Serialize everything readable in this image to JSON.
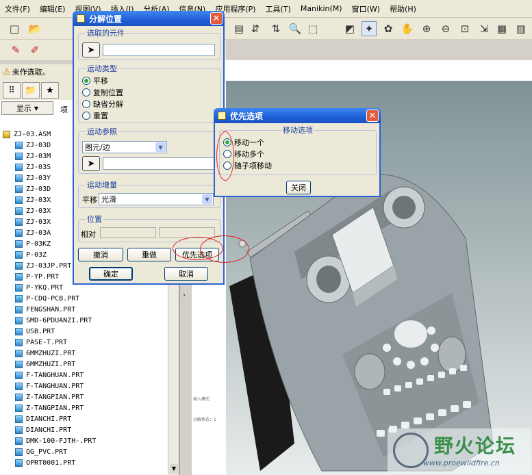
{
  "menubar": [
    "文件(F)",
    "编辑(E)",
    "视图(V)",
    "插入(I)",
    "分析(A)",
    "信息(N)",
    "应用程序(P)",
    "工具(T)",
    "Manikin(M)",
    "窗口(W)",
    "帮助(H)"
  ],
  "status": {
    "message": "未作选取。"
  },
  "left_panel": {
    "show_label": "显示",
    "tree_column": "项",
    "tree_items": [
      "ZJ-03.ASM",
      "ZJ-03D",
      "ZJ-03M",
      "ZJ-03S",
      "ZJ-03Y",
      "ZJ-03D",
      "ZJ-03X",
      "ZJ-03X",
      "ZJ-03X",
      "ZJ-03A",
      "P-03KZ",
      "P-03Z",
      "ZJ-03JP.PRT",
      "P-YP.PRT",
      "P-YKQ.PRT",
      "P-CDQ-PCB.PRT",
      "FENGSHAN.PRT",
      "SMD-6PDUANZI.PRT",
      "USB.PRT",
      "PASE-T.PRT",
      "6MMZHUZI.PRT",
      "6MMZHUZI.PRT",
      "F-TANGHUAN.PRT",
      "F-TANGHUAN.PRT",
      "Z-TANGPIAN.PRT",
      "Z-TANGPIAN.PRT",
      "DIANCHI.PRT",
      "DIANCHI.PRT",
      "DMK-100-FJTH-.PRT",
      "QG_PVC.PRT",
      "OPRT0001.PRT"
    ]
  },
  "explode_dialog": {
    "title": "分解位置",
    "sel_group": "选取的元件",
    "motion_type_group": "运动类型",
    "motion_types": [
      "平移",
      "复制位置",
      "缺省分解",
      "重置"
    ],
    "motion_selected": 0,
    "ref_group": "运动参照",
    "ref_value": "图元/边",
    "increment_group": "运动增量",
    "increment_label": "平移",
    "increment_value": "光滑",
    "position_group": "位置",
    "relative_label": "相对",
    "undo": "撤消",
    "redo": "重做",
    "prefs": "优先选项",
    "ok": "确定",
    "cancel": "取消"
  },
  "prefs_dialog": {
    "title": "优先选项",
    "group": "移动选项",
    "options": [
      "移动一个",
      "移动多个",
      "随子项移动"
    ],
    "selected": 0,
    "close": "关闭"
  },
  "watermark": {
    "text": "野火论坛",
    "url": "www.proewildfire.cn"
  },
  "graphics_notes": [
    "插入模式",
    "分解状态：1"
  ]
}
